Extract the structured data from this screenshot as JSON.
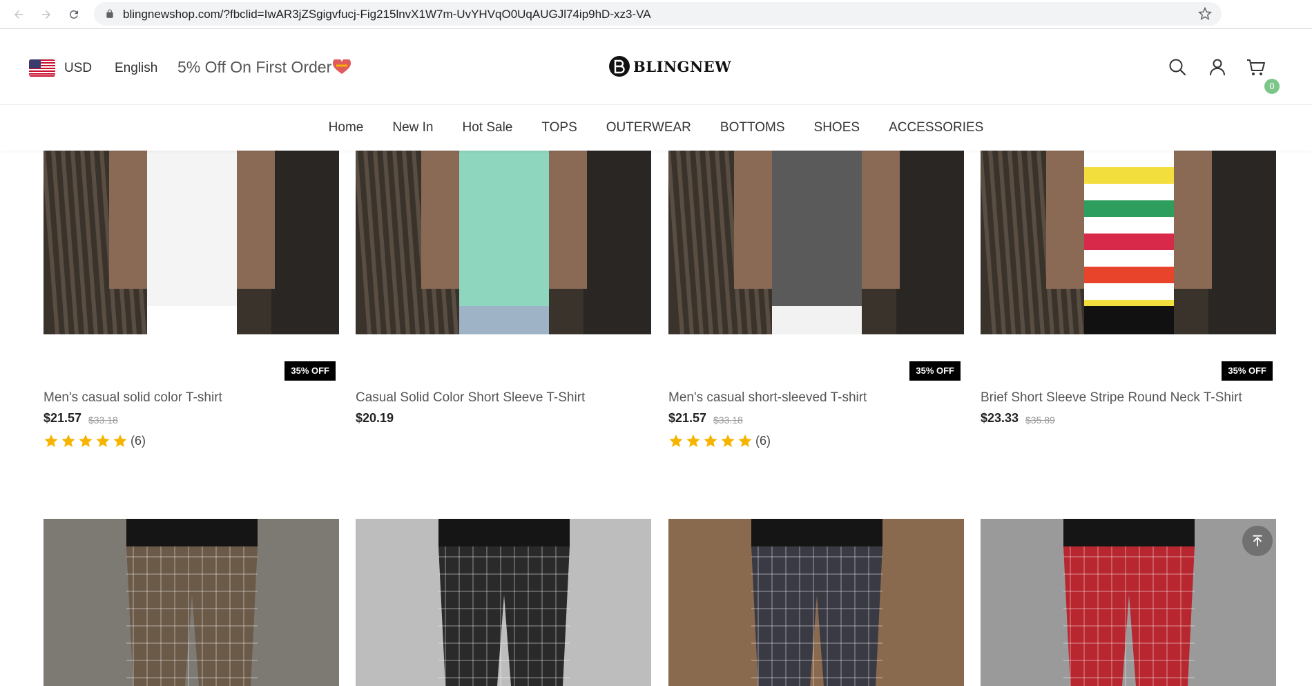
{
  "browser": {
    "url": "blingnewshop.com/?fbclid=IwAR3jZSgigvfucj-Fig215lnvX1W7m-UvYHVqO0UqAUGJl74ip9hD-xz3-VA"
  },
  "header": {
    "currency": "USD",
    "language": "English",
    "promo": "5% Off On First Order",
    "logo_text": "BLINGNEW",
    "cart_count": "0"
  },
  "nav": {
    "items": [
      "Home",
      "New In",
      "Hot Sale",
      "TOPS",
      "OUTERWEAR",
      "BOTTOMS",
      "SHOES",
      "ACCESSORIES"
    ]
  },
  "products": [
    {
      "title": "Men's casual solid color T-shirt",
      "price": "$21.57",
      "old_price": "$33.18",
      "badge": "35% OFF",
      "rating": 5,
      "reviews": "(6)",
      "shirt": "#f4f4f4",
      "accent": "#ffffff"
    },
    {
      "title": "Casual Solid Color Short Sleeve T-Shirt",
      "price": "$20.19",
      "old_price": "",
      "badge": "",
      "rating": 0,
      "reviews": "",
      "shirt": "#8ed6bd",
      "accent": "#9fb3c6"
    },
    {
      "title": "Men's casual short-sleeved T-shirt",
      "price": "$21.57",
      "old_price": "$33.18",
      "badge": "35% OFF",
      "rating": 5,
      "reviews": "(6)",
      "shirt": "#5a5a5a",
      "accent": "#f2f2f2"
    },
    {
      "title": "Brief Short Sleeve Stripe Round Neck T-Shirt",
      "price": "$23.33",
      "old_price": "$35.89",
      "badge": "35% OFF",
      "rating": 0,
      "reviews": "",
      "shirt": "stripes",
      "accent": "#111111"
    }
  ],
  "colors": {
    "badge_bg": "#000000",
    "star": "#f6b400",
    "cart_badge": "#7cc68a"
  }
}
